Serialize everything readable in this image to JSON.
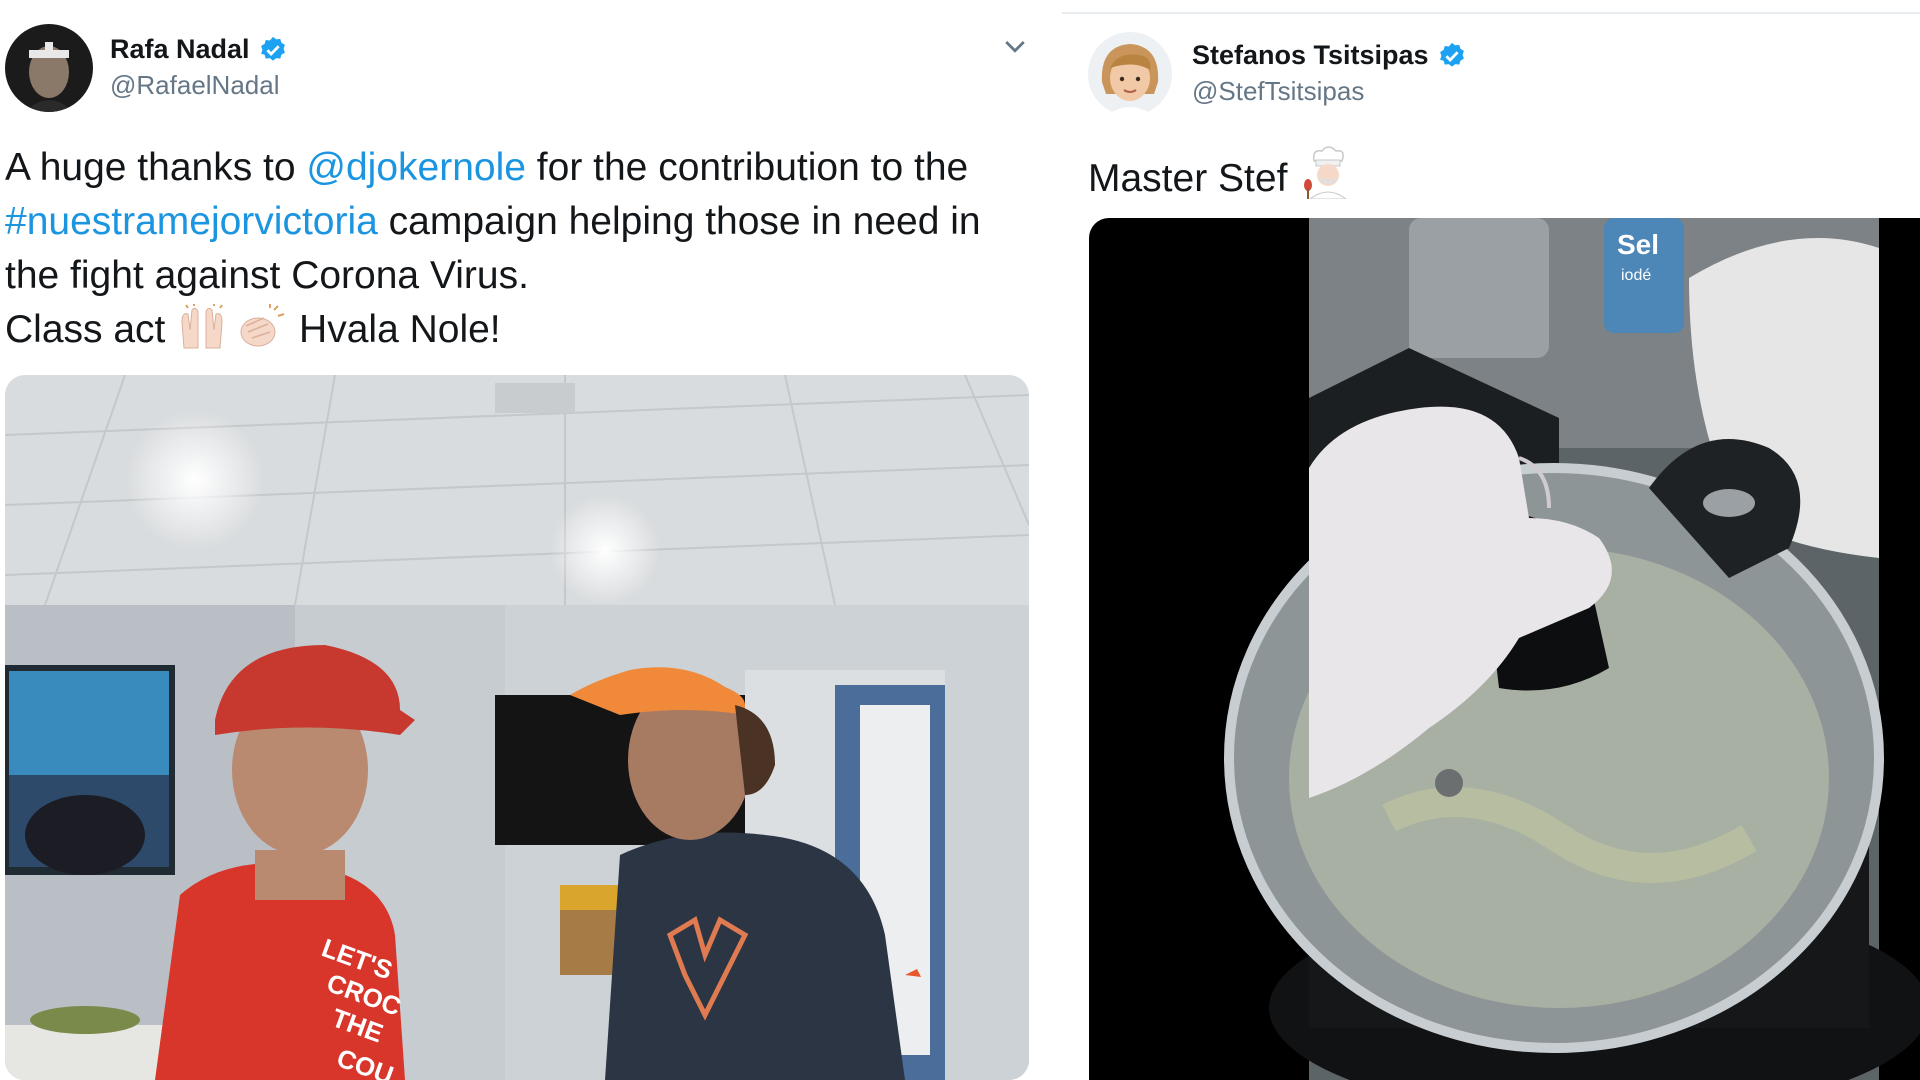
{
  "tweets": [
    {
      "display_name": "Rafa Nadal",
      "handle": "@RafaelNadal",
      "text": {
        "p1": "A huge thanks to ",
        "mention": "@djokernole",
        "p2": " for the contribution to the",
        "hashtag": "#nuestramejorvictoria",
        "p3": " campaign helping those in need in",
        "line3": "the fight against Corona Virus.",
        "line4a": "Class act ",
        "line4b": " Hvala Nole!"
      },
      "emojis": [
        "raising-hands-icon",
        "clapping-hands-icon"
      ],
      "media": {
        "type": "photo",
        "shirt_text": [
          "LET'S",
          "CROC",
          "THE",
          "COU"
        ]
      }
    },
    {
      "display_name": "Stefanos Tsitsipas",
      "handle": "@StefTsitsipas",
      "text": {
        "main": "Master Stef "
      },
      "emojis": [
        "chef-icon"
      ],
      "media": {
        "type": "video",
        "label_text": [
          "Sel",
          "iodé"
        ]
      }
    }
  ],
  "colors": {
    "link": "#1b95e0",
    "verified": "#1da1f2",
    "handle": "#657786",
    "text": "#14171a"
  }
}
